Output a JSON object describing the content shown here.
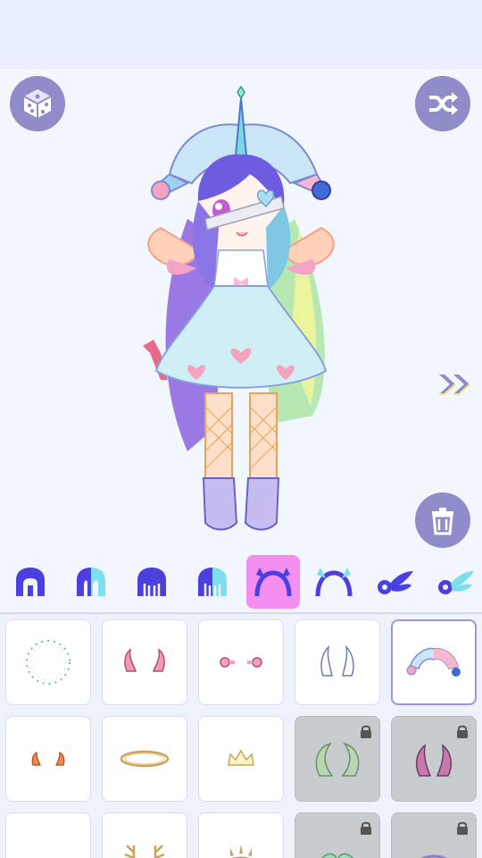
{
  "colors": {
    "top_bar": "#e9efff",
    "stage_bg": "#f1f7fd",
    "button": "#8e8cc9",
    "tab_icon": "#4b3fe0",
    "tab_selected_bg": "#f48ef0",
    "locked_cell": "#c8ccce",
    "selected_border": "#9a95e6"
  },
  "stage_buttons": {
    "random_icon": "dice-icon",
    "shuffle_icon": "shuffle-icon",
    "next_icon": "double-chevron-right-icon",
    "delete_icon": "trash-icon"
  },
  "tabs": [
    {
      "name": "hair-front",
      "icon": "hair-front-icon",
      "selected": false
    },
    {
      "name": "hair-front-color",
      "icon": "hair-front-color-icon",
      "selected": false
    },
    {
      "name": "hair-back",
      "icon": "hair-back-icon",
      "selected": false
    },
    {
      "name": "hair-back-color",
      "icon": "hair-back-color-icon",
      "selected": false
    },
    {
      "name": "horns",
      "icon": "horns-icon",
      "selected": true
    },
    {
      "name": "headband",
      "icon": "headband-icon",
      "selected": false
    },
    {
      "name": "wings",
      "icon": "wing-icon",
      "selected": false
    },
    {
      "name": "wings-color",
      "icon": "wing-color-icon",
      "selected": false
    }
  ],
  "items": [
    {
      "item": "star-wreath",
      "icon": "star-wreath-icon",
      "locked": false,
      "selected": false
    },
    {
      "item": "pink-horns",
      "icon": "pink-horns-icon",
      "locked": false,
      "selected": false
    },
    {
      "item": "pink-studs",
      "icon": "pink-studs-icon",
      "locked": false,
      "selected": false
    },
    {
      "item": "white-feather-horns",
      "icon": "feather-horns-icon",
      "locked": false,
      "selected": false
    },
    {
      "item": "jester-hat",
      "icon": "jester-hat-icon",
      "locked": false,
      "selected": true
    },
    {
      "item": "orange-horns",
      "icon": "orange-horns-icon",
      "locked": false,
      "selected": false
    },
    {
      "item": "gold-halo",
      "icon": "gold-halo-icon",
      "locked": false,
      "selected": false
    },
    {
      "item": "small-crown",
      "icon": "crown-icon",
      "locked": false,
      "selected": false
    },
    {
      "item": "green-leaf-horns",
      "icon": "leaf-horns-icon",
      "locked": true,
      "selected": false
    },
    {
      "item": "dark-horns",
      "icon": "dark-horns-icon",
      "locked": true,
      "selected": false
    },
    {
      "item": "blank",
      "icon": "",
      "locked": false,
      "selected": false
    },
    {
      "item": "antlers",
      "icon": "antlers-icon",
      "locked": false,
      "selected": false
    },
    {
      "item": "sun-crown",
      "icon": "sun-crown-icon",
      "locked": false,
      "selected": false
    },
    {
      "item": "mermaid-tail",
      "icon": "mermaid-ornament-icon",
      "locked": true,
      "selected": false
    },
    {
      "item": "purple-ring",
      "icon": "purple-ring-icon",
      "locked": true,
      "selected": false
    }
  ]
}
